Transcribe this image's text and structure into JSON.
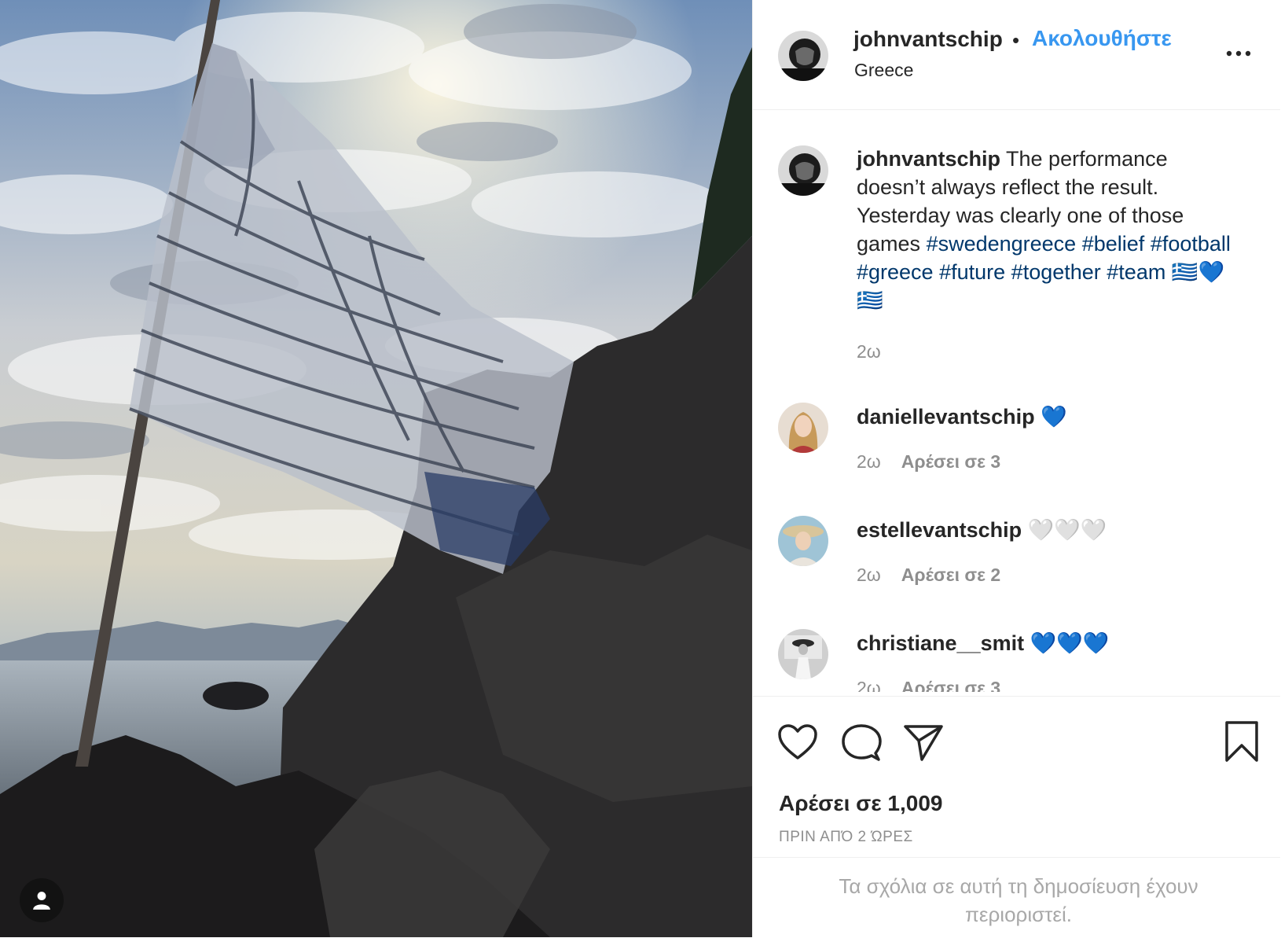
{
  "post": {
    "username": "johnvantschip",
    "dot": "•",
    "follow_label": "Ακολουθήστε",
    "location": "Greece",
    "more_icon": "more-horizontal-icon"
  },
  "caption": {
    "username": "johnvantschip",
    "text": "The performance doesn’t always reflect the result. Yesterday was clearly one of those games",
    "hashtags": [
      "#swedengreece",
      "#belief",
      "#football",
      "#greece",
      "#future",
      "#together",
      "#team"
    ],
    "emoji": "🇬🇷💙🇬🇷",
    "time": "2ω"
  },
  "comments": [
    {
      "username": "daniellevantschip",
      "text": "💙",
      "time": "2ω",
      "likes": "Αρέσει σε 3"
    },
    {
      "username": "estellevantschip",
      "text": "🤍🤍🤍",
      "time": "2ω",
      "likes": "Αρέσει σε 2"
    },
    {
      "username": "christiane__smit",
      "text": "💙💙💙",
      "time": "2ω",
      "likes": "Αρέσει σε 3"
    }
  ],
  "actions": {
    "like_icon": "heart-icon",
    "comment_icon": "comment-icon",
    "share_icon": "share-icon",
    "save_icon": "bookmark-icon",
    "likes_count": "Αρέσει σε 1,009",
    "time_ago": "ΠΡΙΝ ΑΠΌ 2 ΏΡΕΣ"
  },
  "footer": {
    "restricted_text": "Τα σχόλια σε αυτή τη δημοσίευση έχουν περιοριστεί."
  },
  "colors": {
    "link_blue": "#3897f0",
    "hashtag": "#00376b",
    "secondary": "#8e8e8e"
  }
}
